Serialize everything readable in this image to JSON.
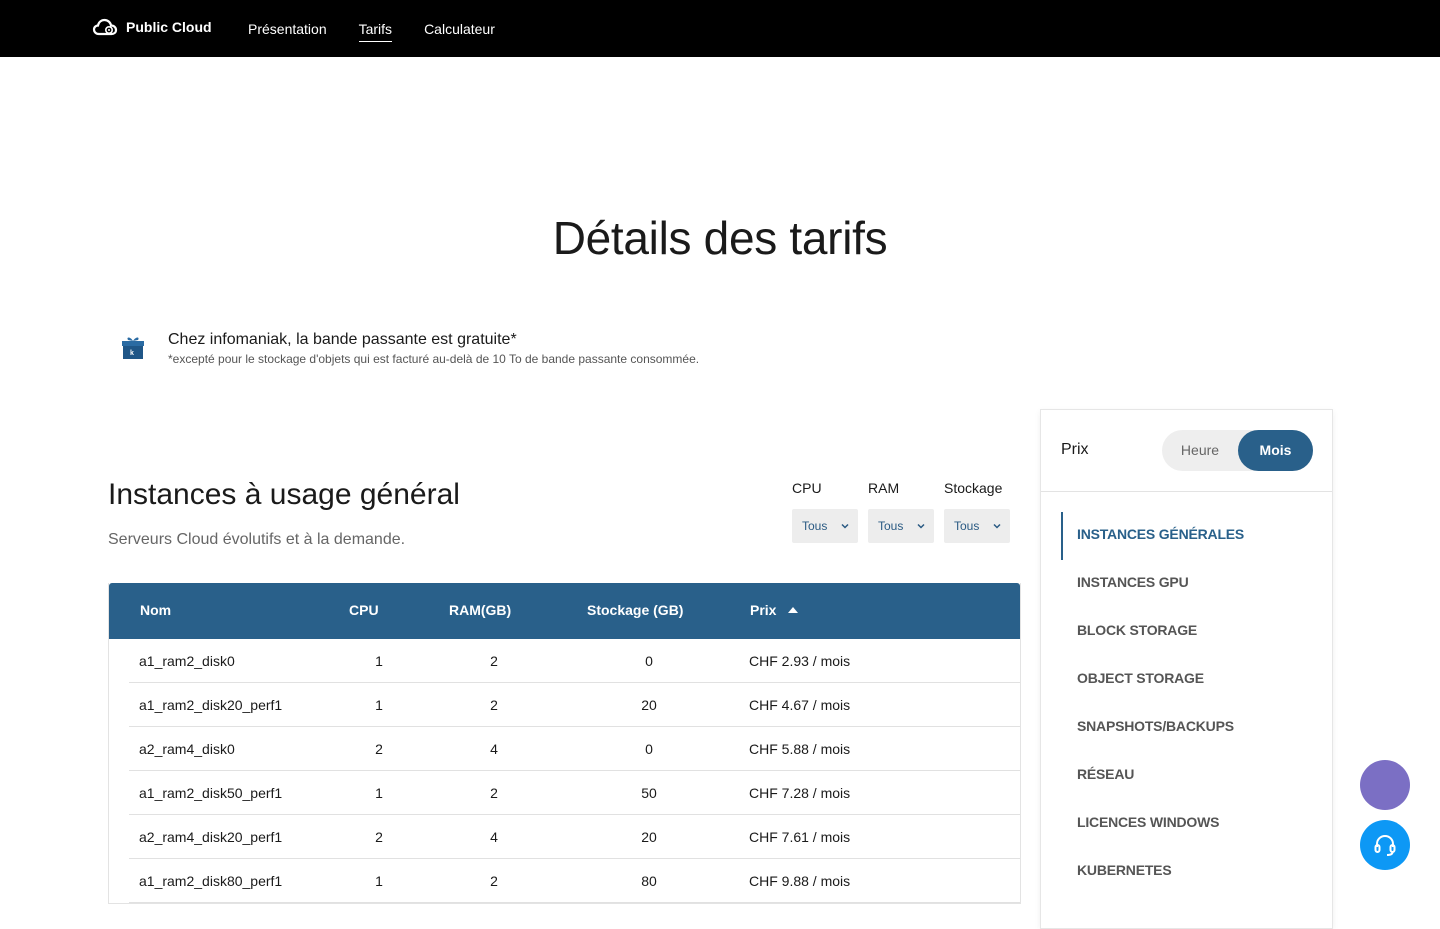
{
  "header": {
    "brand": "Public Cloud",
    "nav": [
      {
        "label": "Présentation",
        "active": false
      },
      {
        "label": "Tarifs",
        "active": true
      },
      {
        "label": "Calculateur",
        "active": false
      }
    ]
  },
  "hero": {
    "title": "Détails des tarifs"
  },
  "notice": {
    "icon": "gift-icon",
    "main": "Chez infomaniak, la bande passante est gratuite*",
    "sub": "*excepté pour le stockage d'objets qui est facturé au-delà de 10 To de bande passante consommée."
  },
  "section": {
    "title": "Instances à usage général",
    "subtitle": "Serveurs Cloud évolutifs et à la demande."
  },
  "filters": [
    {
      "label": "CPU",
      "value": "Tous"
    },
    {
      "label": "RAM",
      "value": "Tous"
    },
    {
      "label": "Stockage",
      "value": "Tous"
    }
  ],
  "table": {
    "headers": {
      "name": "Nom",
      "cpu": "CPU",
      "ram": "RAM(GB)",
      "storage": "Stockage (GB)",
      "price": "Prix"
    },
    "rows": [
      {
        "name": "a1_ram2_disk0",
        "cpu": "1",
        "ram": "2",
        "storage": "0",
        "price": "CHF 2.93 / mois"
      },
      {
        "name": "a1_ram2_disk20_perf1",
        "cpu": "1",
        "ram": "2",
        "storage": "20",
        "price": "CHF 4.67 / mois"
      },
      {
        "name": "a2_ram4_disk0",
        "cpu": "2",
        "ram": "4",
        "storage": "0",
        "price": "CHF 5.88 / mois"
      },
      {
        "name": "a1_ram2_disk50_perf1",
        "cpu": "1",
        "ram": "2",
        "storage": "50",
        "price": "CHF 7.28 / mois"
      },
      {
        "name": "a2_ram4_disk20_perf1",
        "cpu": "2",
        "ram": "4",
        "storage": "20",
        "price": "CHF 7.61 / mois"
      },
      {
        "name": "a1_ram2_disk80_perf1",
        "cpu": "1",
        "ram": "2",
        "storage": "80",
        "price": "CHF 9.88 / mois"
      }
    ]
  },
  "sidebar": {
    "prix_label": "Prix",
    "toggle": {
      "hour": "Heure",
      "month": "Mois",
      "selected": "Mois"
    },
    "items": [
      {
        "label": "INSTANCES GÉNÉRALES",
        "active": true
      },
      {
        "label": "INSTANCES GPU",
        "active": false
      },
      {
        "label": "BLOCK STORAGE",
        "active": false
      },
      {
        "label": "OBJECT STORAGE",
        "active": false
      },
      {
        "label": "SNAPSHOTS/BACKUPS",
        "active": false
      },
      {
        "label": "RÉSEAU",
        "active": false
      },
      {
        "label": "LICENCES WINDOWS",
        "active": false
      },
      {
        "label": "KUBERNETES",
        "active": false
      }
    ]
  },
  "colors": {
    "accent": "#29608a",
    "topbar": "#000000",
    "fab_purple": "#7b6fc4",
    "fab_blue": "#0d98f5"
  }
}
